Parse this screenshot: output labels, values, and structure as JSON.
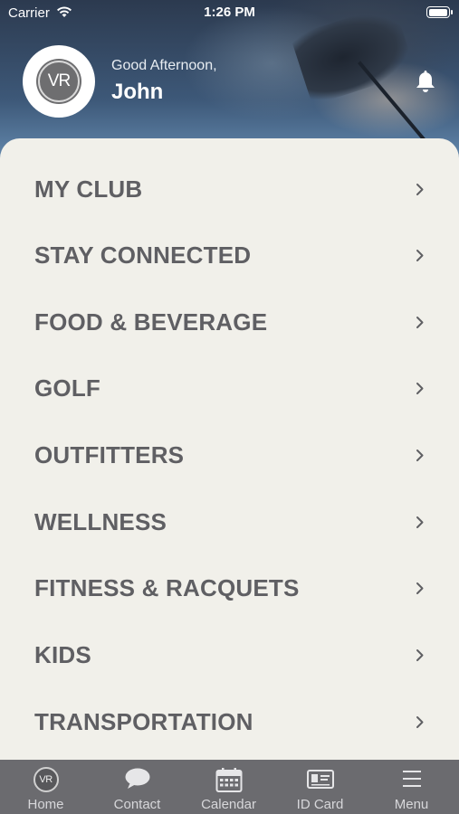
{
  "status_bar": {
    "carrier": "Carrier",
    "time": "1:26 PM"
  },
  "header": {
    "avatar_text": "VR",
    "greeting": "Good Afternoon,",
    "name": "John"
  },
  "menu": {
    "items": [
      {
        "label": "MY CLUB"
      },
      {
        "label": "STAY CONNECTED"
      },
      {
        "label": "FOOD & BEVERAGE"
      },
      {
        "label": "GOLF"
      },
      {
        "label": "OUTFITTERS"
      },
      {
        "label": "WELLNESS"
      },
      {
        "label": "FITNESS & RACQUETS"
      },
      {
        "label": "KIDS"
      },
      {
        "label": "TRANSPORTATION"
      }
    ]
  },
  "tab_bar": {
    "home": {
      "label": "Home",
      "icon": "vr-logo-icon",
      "avatar_text": "VR"
    },
    "contact": {
      "label": "Contact",
      "icon": "chat-bubble-icon"
    },
    "calendar": {
      "label": "Calendar",
      "icon": "calendar-icon"
    },
    "id_card": {
      "label": "ID Card",
      "icon": "id-card-icon"
    },
    "menu": {
      "label": "Menu",
      "icon": "hamburger-icon"
    }
  },
  "colors": {
    "panel_bg": "#f1f0ea",
    "menu_text": "#5f5f63",
    "tab_bar_bg": "#6b6b6f",
    "tab_text": "#d7d7da"
  }
}
